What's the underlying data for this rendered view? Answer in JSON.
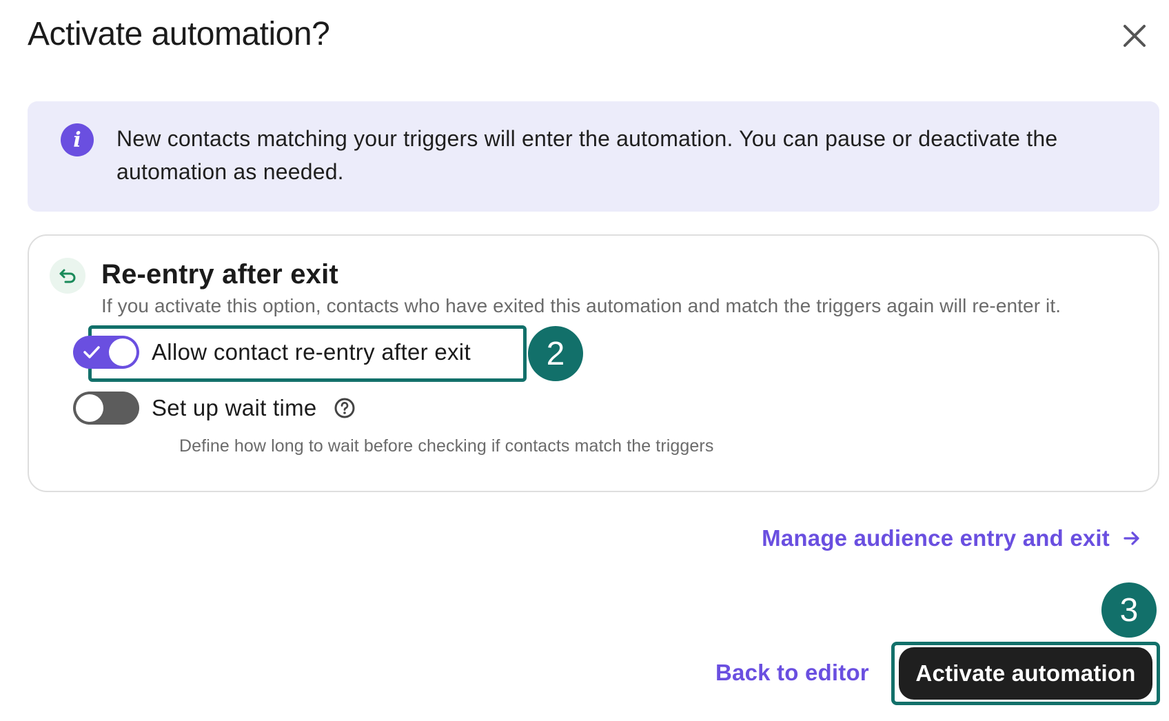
{
  "dialog": {
    "title": "Activate automation?",
    "close_icon": "close-icon"
  },
  "info": {
    "icon": "info-icon",
    "text": "New contacts matching your triggers will enter the automation. You can pause or deactivate the automation as needed."
  },
  "reentry": {
    "icon": "reentry-arrow-icon",
    "title": "Re-entry after exit",
    "description": "If you activate this option, contacts who have exited this automation and match the triggers again will re-enter it.",
    "allow_toggle": {
      "label": "Allow contact re-entry after exit",
      "checked": true
    },
    "wait_toggle": {
      "label": "Set up wait time",
      "checked": false,
      "help_icon": "question-circle-icon"
    },
    "wait_hint": "Define how long to wait before checking if contacts match the triggers"
  },
  "annotations": {
    "step2": "2",
    "step3": "3"
  },
  "links": {
    "manage": "Manage audience entry and exit",
    "manage_icon": "arrow-right-icon"
  },
  "footer": {
    "back_label": "Back to editor",
    "activate_label": "Activate automation"
  },
  "colors": {
    "accent": "#6a4fe0",
    "annotation": "#12706a",
    "info_bg": "#ececfa",
    "primary_button": "#1f1f1f"
  }
}
